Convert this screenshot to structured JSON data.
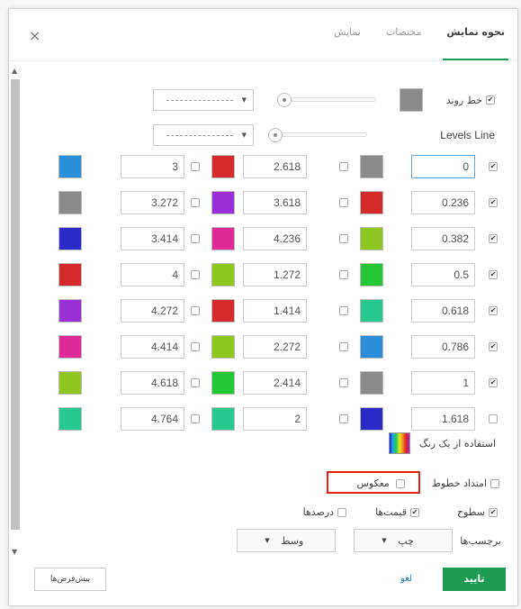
{
  "dialog": {
    "close_glyph": "×",
    "tabs": [
      {
        "label": "نحوه نمایش",
        "active": true
      },
      {
        "label": "مختصات",
        "active": false
      },
      {
        "label": "نمایش",
        "active": false
      }
    ]
  },
  "trend_line": {
    "label": "خط روند",
    "checked": true,
    "color": "#8a8a8a"
  },
  "levels_line": {
    "label": "Levels Line"
  },
  "levels": [
    [
      {
        "checked": true,
        "value": "0",
        "color": "#8a8a8a"
      },
      {
        "checked": false,
        "value": "2.618",
        "color": "#d42a2a"
      },
      {
        "checked": false,
        "value": "3",
        "color": "#2a8fd6"
      }
    ],
    [
      {
        "checked": true,
        "value": "0.236",
        "color": "#d42a2a"
      },
      {
        "checked": false,
        "value": "3.618",
        "color": "#9b2fd6"
      },
      {
        "checked": false,
        "value": "3.272",
        "color": "#8a8a8a"
      }
    ],
    [
      {
        "checked": true,
        "value": "0.382",
        "color": "#8fc61f"
      },
      {
        "checked": false,
        "value": "4.236",
        "color": "#dd2a97"
      },
      {
        "checked": false,
        "value": "3.414",
        "color": "#2a2ac9"
      }
    ],
    [
      {
        "checked": true,
        "value": "0.5",
        "color": "#22c733"
      },
      {
        "checked": false,
        "value": "1.272",
        "color": "#8fc61f"
      },
      {
        "checked": false,
        "value": "4",
        "color": "#d42a2a"
      }
    ],
    [
      {
        "checked": true,
        "value": "0.618",
        "color": "#27c98f"
      },
      {
        "checked": false,
        "value": "1.414",
        "color": "#d42a2a"
      },
      {
        "checked": false,
        "value": "4.272",
        "color": "#9b2fd6"
      }
    ],
    [
      {
        "checked": true,
        "value": "0.786",
        "color": "#2a8fd6"
      },
      {
        "checked": false,
        "value": "2.272",
        "color": "#8fc61f"
      },
      {
        "checked": false,
        "value": "4.414",
        "color": "#dd2a97"
      }
    ],
    [
      {
        "checked": true,
        "value": "1",
        "color": "#8a8a8a"
      },
      {
        "checked": false,
        "value": "2.414",
        "color": "#22c733"
      },
      {
        "checked": false,
        "value": "4.618",
        "color": "#8fc61f"
      }
    ],
    [
      {
        "checked": false,
        "value": "1.618",
        "color": "#2a2ac9"
      },
      {
        "checked": false,
        "value": "2",
        "color": "#27c98f"
      },
      {
        "checked": false,
        "value": "4.764",
        "color": "#27c98f"
      }
    ]
  ],
  "single_color": {
    "label": "استفاده از یک رنگ"
  },
  "extend_lines": {
    "label": "امتداد خطوط",
    "checked": false
  },
  "reverse": {
    "label": "معکوس",
    "checked": false
  },
  "levels_opt": {
    "label": "سطوح",
    "checked": true
  },
  "prices_opt": {
    "label": "قیمت‌ها",
    "checked": true
  },
  "percents_opt": {
    "label": "درصدها",
    "checked": false
  },
  "labels_row": {
    "label": "برچسب‌ها",
    "horizontal_value": "چپ",
    "vertical_value": "وسط"
  },
  "footer": {
    "ok": "تایید",
    "cancel": "لغو",
    "defaults": "پیش‌فرض‌ها"
  },
  "colors": {
    "accent": "#1b9c52",
    "highlight": "#e2231a"
  }
}
